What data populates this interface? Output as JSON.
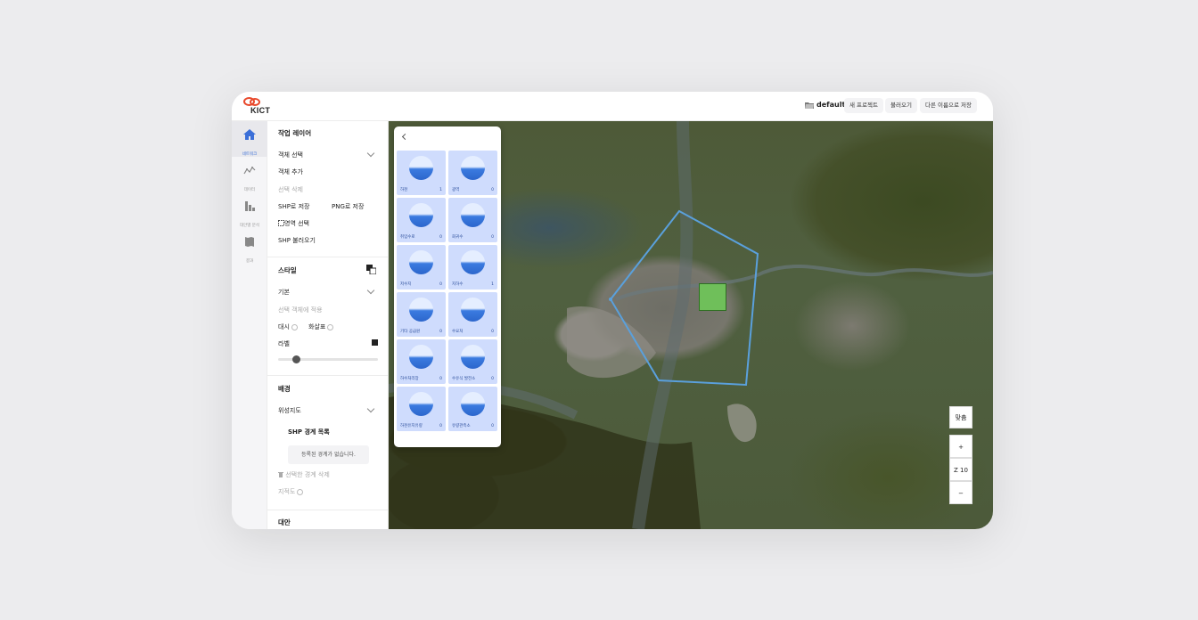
{
  "header": {
    "logo_text": "KICT",
    "project_name": "default",
    "buttons": [
      "새 프로젝트",
      "불러오기",
      "다른 이름으로 저장"
    ]
  },
  "nav": {
    "items": [
      {
        "label": "네트워크",
        "icon": "home-icon",
        "active": true
      },
      {
        "label": "데이터",
        "icon": "chart-line-icon",
        "active": false
      },
      {
        "label": "대안별 분석",
        "icon": "bar-chart-icon",
        "active": false
      },
      {
        "label": "결과",
        "icon": "map-icon",
        "active": false
      }
    ]
  },
  "sidebar": {
    "work_layer_title": "작업 레이어",
    "object_select": "객체 선택",
    "add_object": "객체 추가",
    "delete_selection": "선택 삭제",
    "save_shp": "SHP로 저장",
    "save_png": "PNG로 저장",
    "area_select": "영역 선택",
    "load_shp": "SHP 불러오기",
    "style_title": "스타일",
    "style_default": "기본",
    "apply_selected": "선택 객체에 적용",
    "dash": "대시",
    "arrow": "화살표",
    "label": "라벨",
    "slider_value": 0.18,
    "background_title": "배경",
    "basemap": "위성지도",
    "shp_boundary_title": "SHP 경계 목록",
    "no_boundary": "등록된 경계가 없습니다.",
    "delete_boundary": "선택한 경계 삭제",
    "cadastral": "지적도",
    "alternative_title": "대안"
  },
  "panel": {
    "cards": [
      {
        "name": "하천",
        "count": "1",
        "icon": "river-icon"
      },
      {
        "name": "광역",
        "count": "0",
        "icon": "regional-supply-icon"
      },
      {
        "name": "취입수로",
        "count": "0",
        "icon": "intake-channel-icon"
      },
      {
        "name": "회귀수",
        "count": "0",
        "icon": "return-flow-icon"
      },
      {
        "name": "저수지",
        "count": "0",
        "icon": "reservoir-icon"
      },
      {
        "name": "지하수",
        "count": "1",
        "icon": "groundwater-icon"
      },
      {
        "name": "기타 공급원",
        "count": "0",
        "icon": "other-source-icon"
      },
      {
        "name": "수요처",
        "count": "0",
        "icon": "demand-icon"
      },
      {
        "name": "하수처리장",
        "count": "0",
        "icon": "sewage-plant-icon"
      },
      {
        "name": "수유식 발전소",
        "count": "0",
        "icon": "hydro-plant-icon"
      },
      {
        "name": "하천유지유량",
        "count": "0",
        "icon": "instream-flow-icon"
      },
      {
        "name": "유량관측소",
        "count": "0",
        "icon": "gauge-station-icon"
      }
    ]
  },
  "map": {
    "fit_label": "맞춤",
    "zoom_in": "+",
    "zoom_level": "Z 10",
    "zoom_out": "−",
    "polygon_color": "#5aa0dc",
    "feature_color": "#6fbf5a"
  }
}
